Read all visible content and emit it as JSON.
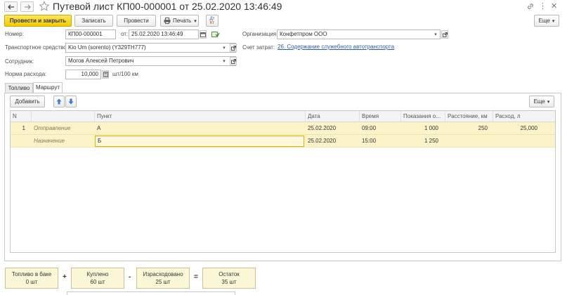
{
  "header": {
    "title": "Путевой лист КП00-000001 от 25.02.2020 13:46:49",
    "more_label": "Еще",
    "more_arrow": "▾"
  },
  "toolbar": {
    "post_close_label": "Провести и закрыть",
    "save_label": "Записать",
    "post_label": "Провести",
    "print_label": "Печать",
    "dtkt_top": "Дт",
    "dtkt_bottom": "Кт"
  },
  "form": {
    "number_label": "Номер:",
    "number_value": "КП00-000001",
    "date_label": "от:",
    "date_value": "25.02.2020 13:46:49",
    "org_label": "Организация:",
    "org_value": "Конфетпром ООО",
    "vehicle_label": "Транспортное средство:",
    "vehicle_value": "Kio Um (sorento) (Y329TH777)",
    "account_label": "Счет затрат:",
    "account_value": "26. Содержание служебного автотранспорта",
    "employee_label": "Сотрудник:",
    "employee_value": "Могов Алексей Петрович",
    "norm_label": "Норма расхода:",
    "norm_value": "10,000",
    "norm_unit": "шт/100 км"
  },
  "tabs": [
    {
      "label": "Топливо",
      "active": false
    },
    {
      "label": "Маршрут",
      "active": true
    }
  ],
  "route": {
    "add_label": "Добавить",
    "more_label": "Еще",
    "columns": [
      "N",
      "Пункт",
      "Дата",
      "Время",
      "Показания о...",
      "Расстояние, км",
      "Расход, л"
    ],
    "rows": [
      {
        "n": "1",
        "type": "Отправление",
        "point": "А",
        "date": "25.02.2020",
        "time": "09:00",
        "odometer": "1 000",
        "distance": "250",
        "consumption": "25,000"
      },
      {
        "n": "",
        "type": "Назначение",
        "point": "Б",
        "date": "25.02.2020",
        "time": "15:00",
        "odometer": "1 250",
        "distance": "",
        "consumption": ""
      }
    ]
  },
  "summary": {
    "items": [
      {
        "label": "Топливо в баке",
        "value": "0 шт"
      },
      {
        "label": "Куплено",
        "value": "60 шт"
      },
      {
        "label": "Израсходовано",
        "value": "25 шт"
      },
      {
        "label": "Остаток",
        "value": "35 шт"
      }
    ],
    "ops": [
      "+",
      "-",
      "="
    ]
  },
  "colors": {
    "accent_yellow": "#f3cb00",
    "row_highlight": "#fdf3c9",
    "link": "#2c5cae",
    "summary_bg": "#fbf7d6"
  }
}
